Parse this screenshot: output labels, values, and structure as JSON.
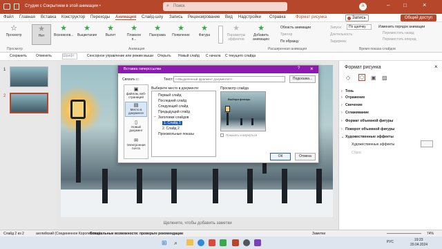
{
  "titlebar": {
    "doc_title": "Студия с Сокрытием в этой анимации •",
    "search_placeholder": "Поиск",
    "record_label": "Запись",
    "share_label": "Общий доступ",
    "user_initial": "A"
  },
  "menu": [
    {
      "label": "Файл"
    },
    {
      "label": "Главная"
    },
    {
      "label": "Вставка"
    },
    {
      "label": "Конструктор"
    },
    {
      "label": "Переходы"
    },
    {
      "label": "Анимация"
    },
    {
      "label": "Слайд-шоу"
    },
    {
      "label": "Запись"
    },
    {
      "label": "Рецензирование"
    },
    {
      "label": "Вид"
    },
    {
      "label": "Надстройки"
    },
    {
      "label": "Справка"
    },
    {
      "label": "Формат рисунка"
    }
  ],
  "ribbon": {
    "preview_label": "Просмотр",
    "preview_group": "Просмотр",
    "anim_group": "Анимация",
    "adv_group": "Расширенная анимация",
    "timing_group": "Время показа слайдов",
    "effects_label": "Параметры эффектов",
    "add_anim_label": "Добавить анимацию",
    "anim_pane": "Область анимации",
    "trigger": "Триггер",
    "anim_painter": "По образцу",
    "start_label": "Запуск:",
    "start_value": "По щелчку",
    "duration_label": "Длительность:",
    "delay_label": "Задержка:",
    "reorder": "Изменить порядок анимации",
    "move_earlier": "Переместить назад",
    "move_later": "Переместить вперед",
    "gallery": [
      {
        "label": "Нет"
      },
      {
        "label": "Возникнов..."
      },
      {
        "label": "Выцветание"
      },
      {
        "label": "Вылет"
      },
      {
        "label": "Плавное п..."
      },
      {
        "label": "Панорама"
      },
      {
        "label": "Появление"
      },
      {
        "label": "Фигура"
      }
    ]
  },
  "qat": {
    "save": "Сохранить",
    "undo": "Отменить",
    "font_placeholder": "Шрифт",
    "voice": "Сенсорное управление или режим мыши",
    "open": "Открыть",
    "new_slide": "Новый слайд",
    "from_start": "С начала",
    "from_current": "С текущего слайда"
  },
  "thumbs": [
    {
      "num": "1"
    },
    {
      "num": "2"
    }
  ],
  "slide": {
    "notes": "Щелкните, чтобы добавить заметки"
  },
  "dialog": {
    "title": "Вставка гиперссылки",
    "help": "?",
    "close": "×",
    "link_to": "Связать с:",
    "text_label": "Текст:",
    "text_value": "<<Выделенный фрагмент документа>>",
    "tooltip_btn": "Подсказка...",
    "places": [
      {
        "label": "файлом, веб-страницей"
      },
      {
        "label": "Место в документе"
      },
      {
        "label": "Новый документ"
      },
      {
        "label": "Электронная почта"
      }
    ],
    "place_label": "Выберите место в документе:",
    "tree": [
      {
        "label": "Первый слайд"
      },
      {
        "label": "Последний слайд"
      },
      {
        "label": "Следующий слайд"
      },
      {
        "label": "Предыдущий слайд"
      },
      {
        "label": "Заголовки слайдов"
      },
      {
        "label": "1. Слайд 1"
      },
      {
        "label": "2. Слайд 2"
      },
      {
        "label": "Произвольные показы"
      }
    ],
    "preview_label": "Просмотр слайда",
    "preview_title": "Выбери фонарь",
    "show_return": "Показать и вернуться",
    "ok": "ОК",
    "cancel": "Отмена"
  },
  "pane": {
    "title": "Формат рисунка",
    "close": "×",
    "items": [
      {
        "label": "Тень"
      },
      {
        "label": "Отражение"
      },
      {
        "label": "Свечение"
      },
      {
        "label": "Сглаживание"
      },
      {
        "label": "Формат объемной фигуры"
      },
      {
        "label": "Поворот объемной фигуры"
      },
      {
        "label": "Художественные эффекты"
      }
    ],
    "art_effects_label": "Художественные эффекты",
    "reset_label": "Сброс"
  },
  "status": {
    "slide": "Слайд 2 из 2",
    "lang": "английский (Соединенное Королевство)",
    "access": "Специальные возможности: проверьте рекомендации",
    "notes": "Заметки",
    "zoom": "74%"
  },
  "taskbar": {
    "lang": "РУС",
    "time": "19:23",
    "date": "20.04.2024"
  },
  "colors": {
    "accent": "#b7472a",
    "dialog_title": "#8d1ab0",
    "anim_green": "#3aa84b"
  }
}
